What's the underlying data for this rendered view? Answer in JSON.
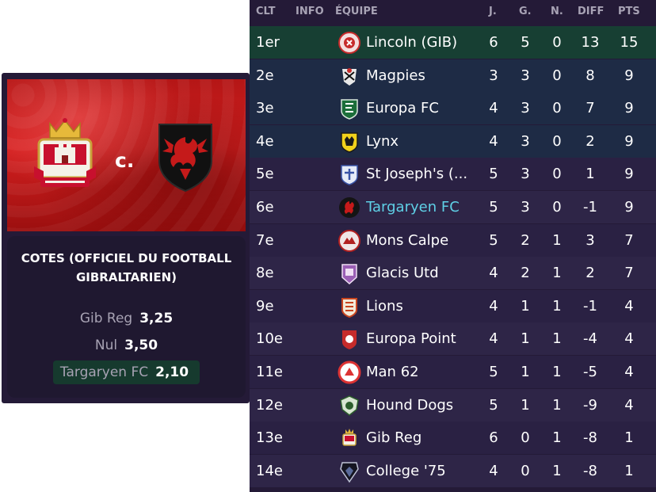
{
  "odds_card": {
    "versus": "c.",
    "title": "COTES (OFFICIEL DU FOOTBALL GIBRALTARIEN)",
    "odds": [
      {
        "label": "Gib Reg",
        "value": "3,25"
      },
      {
        "label": "Nul",
        "value": "3,50"
      },
      {
        "label": "Targaryen FC",
        "value": "2,10",
        "highlight": true
      }
    ]
  },
  "table": {
    "headers": {
      "pos": "CLT",
      "info": "INFO",
      "team": "ÉQUIPE",
      "p": "J.",
      "w": "G.",
      "d": "N.",
      "gd": "DIFF",
      "pts": "PTS"
    },
    "rows": [
      {
        "pos": "1er",
        "team": "Lincoln (GIB)",
        "p": "6",
        "w": "5",
        "d": "0",
        "gd": "13",
        "pts": "15",
        "zone": "green",
        "logo": "lincoln-crest-icon"
      },
      {
        "pos": "2e",
        "team": "Magpies",
        "p": "3",
        "w": "3",
        "d": "0",
        "gd": "8",
        "pts": "9",
        "zone": "blue",
        "logo": "magpies-crest-icon"
      },
      {
        "pos": "3e",
        "team": "Europa FC",
        "p": "4",
        "w": "3",
        "d": "0",
        "gd": "7",
        "pts": "9",
        "zone": "blue",
        "logo": "europa-fc-crest-icon"
      },
      {
        "pos": "4e",
        "team": "Lynx",
        "p": "4",
        "w": "3",
        "d": "0",
        "gd": "2",
        "pts": "9",
        "zone": "blue",
        "logo": "lynx-crest-icon"
      },
      {
        "pos": "5e",
        "team": "St Joseph's (...",
        "p": "5",
        "w": "3",
        "d": "0",
        "gd": "1",
        "pts": "9",
        "zone": "plain",
        "logo": "st-josephs-crest-icon"
      },
      {
        "pos": "6e",
        "team": "Targaryen FC",
        "p": "5",
        "w": "3",
        "d": "0",
        "gd": "-1",
        "pts": "9",
        "zone": "plain",
        "user": true,
        "logo": "targaryen-crest-icon"
      },
      {
        "pos": "7e",
        "team": "Mons Calpe",
        "p": "5",
        "w": "2",
        "d": "1",
        "gd": "3",
        "pts": "7",
        "zone": "plain",
        "logo": "mons-calpe-crest-icon"
      },
      {
        "pos": "8e",
        "team": "Glacis Utd",
        "p": "4",
        "w": "2",
        "d": "1",
        "gd": "2",
        "pts": "7",
        "zone": "plain",
        "logo": "glacis-crest-icon"
      },
      {
        "pos": "9e",
        "team": "Lions",
        "p": "4",
        "w": "1",
        "d": "1",
        "gd": "-1",
        "pts": "4",
        "zone": "plain",
        "logo": "lions-crest-icon"
      },
      {
        "pos": "10e",
        "team": "Europa Point",
        "p": "4",
        "w": "1",
        "d": "1",
        "gd": "-4",
        "pts": "4",
        "zone": "plain",
        "logo": "europa-point-crest-icon"
      },
      {
        "pos": "11e",
        "team": "Man 62",
        "p": "5",
        "w": "1",
        "d": "1",
        "gd": "-5",
        "pts": "4",
        "zone": "plain",
        "logo": "man-62-crest-icon"
      },
      {
        "pos": "12e",
        "team": "Hound Dogs",
        "p": "5",
        "w": "1",
        "d": "1",
        "gd": "-9",
        "pts": "4",
        "zone": "plain",
        "logo": "hound-dogs-crest-icon"
      },
      {
        "pos": "13e",
        "team": "Gib Reg",
        "p": "6",
        "w": "0",
        "d": "1",
        "gd": "-8",
        "pts": "1",
        "zone": "plain",
        "logo": "gib-reg-crest-icon"
      },
      {
        "pos": "14e",
        "team": "College '75",
        "p": "4",
        "w": "0",
        "d": "1",
        "gd": "-8",
        "pts": "1",
        "zone": "plain",
        "logo": "college-75-crest-icon"
      }
    ]
  },
  "colors": {
    "user_team": "#5fd0e6",
    "leader_zone": "#173f33",
    "upper_zone": "#1e2b45",
    "background": "#241a37"
  }
}
